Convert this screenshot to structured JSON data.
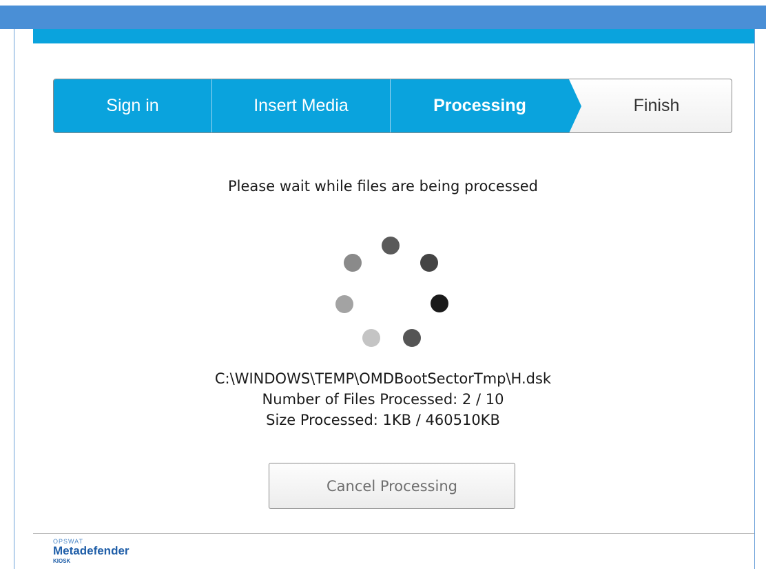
{
  "steps": [
    {
      "label": "Sign in",
      "state": "done"
    },
    {
      "label": "Insert Media",
      "state": "done"
    },
    {
      "label": "Processing",
      "state": "active"
    },
    {
      "label": "Finish",
      "state": "pending"
    }
  ],
  "main": {
    "message": "Please wait while files are being processed",
    "current_file": "C:\\WINDOWS\\TEMP\\OMDBootSectorTmp\\H.dsk",
    "files_processed": "Number of Files Processed: 2 / 10",
    "size_processed": "Size Processed: 1KB / 460510KB",
    "cancel_label": "Cancel Processing"
  },
  "spinner": {
    "icon": "loading-spinner-icon",
    "dot_colors": [
      "#5a5a5a",
      "#444444",
      "#1a1a1a",
      "#555555",
      "#c4c4c4",
      "#a3a3a3",
      "#8a8a8a"
    ]
  },
  "footer": {
    "logo_top": "OPSWAT",
    "logo_main": "Metadefender",
    "logo_sub": "KIOSK"
  },
  "colors": {
    "accent": "#0aa3dd",
    "title_strip": "#4a8fd6"
  }
}
